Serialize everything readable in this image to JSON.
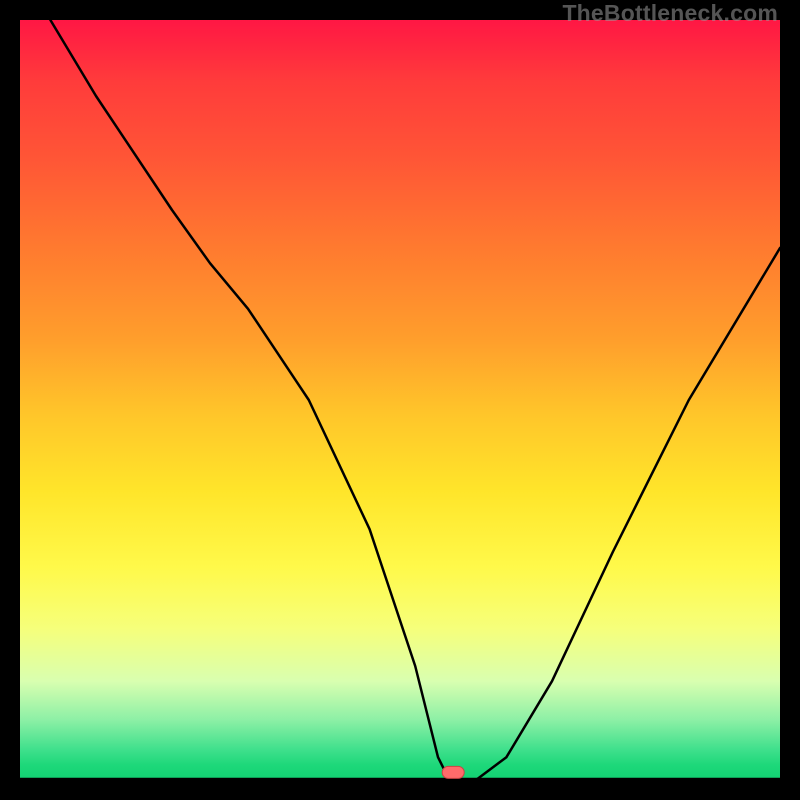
{
  "watermark": "TheBottleneck.com",
  "chart_data": {
    "type": "line",
    "title": "",
    "xlabel": "",
    "ylabel": "",
    "xlim": [
      0,
      100
    ],
    "ylim": [
      0,
      100
    ],
    "grid": false,
    "legend": false,
    "series": [
      {
        "name": "bottleneck-curve",
        "x": [
          4,
          10,
          20,
          25,
          30,
          38,
          46,
          52,
          55,
          56,
          58,
          60,
          64,
          70,
          78,
          88,
          100
        ],
        "y": [
          100,
          90,
          75,
          68,
          62,
          50,
          33,
          15,
          3,
          1,
          0,
          0,
          3,
          13,
          30,
          50,
          70
        ]
      }
    ],
    "marker": {
      "x": 57,
      "y": 1,
      "shape": "pill",
      "color": "#ff6b6b"
    },
    "background_gradient": {
      "orientation": "vertical",
      "stops": [
        {
          "pos": 0.0,
          "color": "#ff1744"
        },
        {
          "pos": 0.5,
          "color": "#ffc62a"
        },
        {
          "pos": 0.8,
          "color": "#f6ff7a"
        },
        {
          "pos": 1.0,
          "color": "#11d172"
        }
      ]
    }
  }
}
